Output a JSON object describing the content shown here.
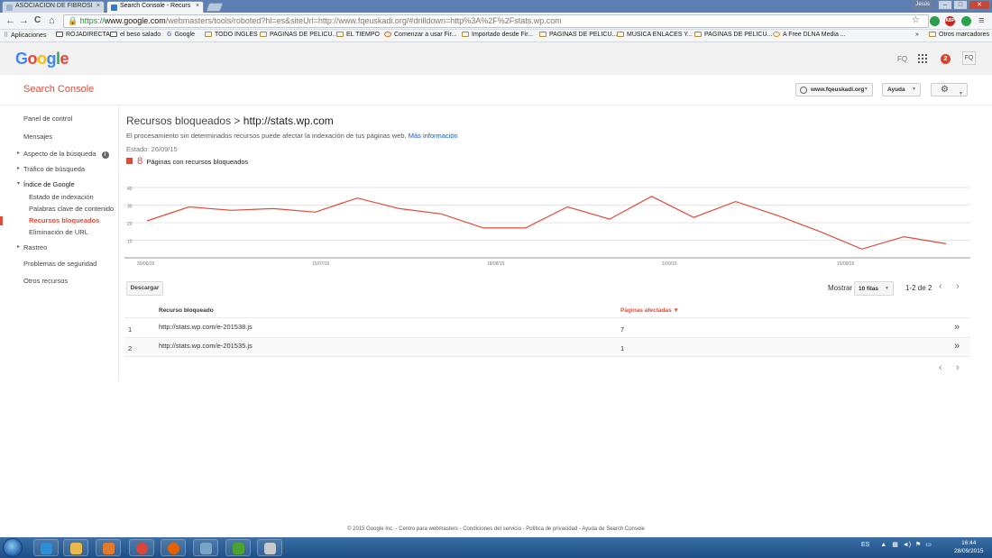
{
  "browser": {
    "tabs": [
      {
        "title": "ASOCIACIÓN DE FIBROSI",
        "close": "×"
      },
      {
        "title": "Search Console - Recurs",
        "close": "×"
      }
    ],
    "window_user": "Jesús",
    "window_buttons": {
      "minimize": "–",
      "maximize": "□",
      "close": "✕"
    },
    "nav": {
      "back": "←",
      "forward": "→",
      "reload": "C",
      "home": "⌂"
    },
    "url": {
      "scheme": "https://",
      "host": "www.google.com",
      "path": "/webmasters/tools/roboted?hl=es&siteUrl=http://www.fqeuskadi.org/#drilldown=http%3A%2F%2Fstats.wp.com"
    },
    "star": "☆",
    "extensions": [
      {
        "label": "",
        "color": "#2e9c4a"
      },
      {
        "label": "ABP",
        "color": "#c8261d"
      },
      {
        "label": "",
        "color": "#2aa14b"
      }
    ],
    "menu": "≡",
    "bookmarks": [
      "Aplicaciones",
      "ROJADIRECTA",
      "el beso salado",
      "Google",
      "TODO INGLES",
      "PAGINAS DE PELICU...",
      "EL TIEMPO",
      "Comenzar a usar Fir...",
      "Importado desde Fir...",
      "PAGINAS DE PELICU...",
      "MUSICA ENLACES Y...",
      "PAGINAS DE PELICU...",
      "A Free DLNA Media ..."
    ],
    "bookmarks_overflow": "»",
    "other_bookmarks": "Otros marcadores"
  },
  "google_header": {
    "logo_letters": [
      {
        "ch": "G",
        "color": "#4285f4"
      },
      {
        "ch": "o",
        "color": "#ea4335"
      },
      {
        "ch": "o",
        "color": "#fbbc05"
      },
      {
        "ch": "g",
        "color": "#4285f4"
      },
      {
        "ch": "l",
        "color": "#34a853"
      },
      {
        "ch": "e",
        "color": "#ea4335"
      }
    ],
    "user_initials": "FQ",
    "notifications": "2",
    "avatar": "FQ"
  },
  "console": {
    "title": "Search Console",
    "site": "www.fqeuskadi.org",
    "help": "Ayuda",
    "settings_icon": "⚙"
  },
  "sidebar": {
    "items": [
      {
        "label": "Panel de control"
      },
      {
        "label": "Mensajes"
      },
      {
        "label": "Aspecto de la búsqueda",
        "arrow": "▸",
        "info": "i"
      },
      {
        "label": "Tráfico de búsqueda",
        "arrow": "▸"
      },
      {
        "label": "Índice de Google",
        "arrow": "▾"
      },
      {
        "label": "Estado de indexación"
      },
      {
        "label": "Palabras clave de contenido"
      },
      {
        "label": "Recursos bloqueados"
      },
      {
        "label": "Eliminación de URL"
      },
      {
        "label": "Rastreo",
        "arrow": "▸"
      },
      {
        "label": "Problemas de seguridad"
      },
      {
        "label": "Otros recursos"
      }
    ]
  },
  "main": {
    "title_prefix": "Recursos bloqueados >",
    "title_host": "http://stats.wp.com",
    "description": "El procesamiento sin determinados recursos puede afectar la indexación de tus páginas web.",
    "more_info": "Más información",
    "status": "Estado: 26/09/15",
    "legend_count": "8",
    "legend_label": "Páginas con recursos bloqueados",
    "download": "Descargar",
    "show_label": "Mostrar",
    "rows_option": "10 filas",
    "range": "1-2 de 2",
    "prev": "‹",
    "next": "›",
    "table": {
      "col_resource": "Recurso bloqueado",
      "col_pages": "Páginas afectadas ▼",
      "rows": [
        {
          "index": "1",
          "resource": "http://stats.wp.com/e-201538.js",
          "pages": "7",
          "more": "»"
        },
        {
          "index": "2",
          "resource": "http://stats.wp.com/e-201535.js",
          "pages": "1",
          "more": "»"
        }
      ]
    }
  },
  "chart_data": {
    "type": "line",
    "series": [
      {
        "values": [
          21,
          29,
          27,
          28,
          26,
          34,
          28,
          25,
          17,
          17,
          29,
          22,
          35,
          23,
          32,
          24,
          15,
          5,
          12,
          8
        ]
      }
    ],
    "ylim": [
      0,
      40
    ],
    "yticks": [
      "40",
      "30",
      "20",
      "10"
    ],
    "xticks": [
      "30/06/15",
      "15/07/15",
      "18/08/15",
      "1/09/15",
      "15/09/15"
    ],
    "grid": true,
    "line_color": "#dd4b39"
  },
  "footer": "© 2015 Google Inc. - Centro para webmasters - Condiciones del servicio - Política de privacidad - Ayuda de Search Console",
  "taskbar": {
    "apps": [
      {
        "name": "ie",
        "color": "#2b8fd6"
      },
      {
        "name": "explorer",
        "color": "#e9b94a"
      },
      {
        "name": "media",
        "color": "#e27a2e"
      },
      {
        "name": "chrome",
        "color": "#db4437"
      },
      {
        "name": "firefox",
        "color": "#e66000"
      },
      {
        "name": "folder",
        "color": "#7aa3c8"
      },
      {
        "name": "utorrent",
        "color": "#4aa232"
      },
      {
        "name": "paint",
        "color": "#c9c9c9"
      }
    ],
    "language": "ES",
    "time": "16:44",
    "date": "28/09/2015"
  }
}
